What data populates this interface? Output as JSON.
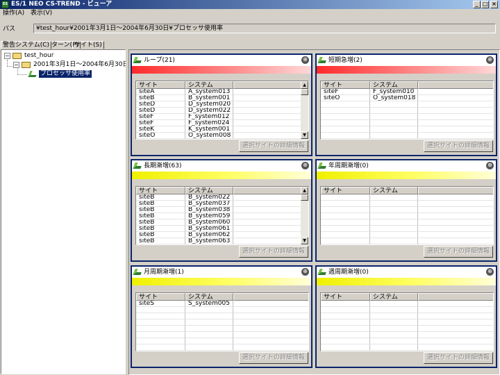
{
  "window": {
    "title": "ES/1 NEO CS-TREND - ビューア",
    "icon_text": "ES",
    "controls": [
      "_",
      "□",
      "×"
    ]
  },
  "menu": {
    "items": [
      "操作(A)",
      "表示(V)"
    ]
  },
  "path": {
    "label": "パス",
    "value": "¥test_hour¥2001年3月1日～2004年6月30日¥プロセッサ使用率"
  },
  "tabs": [
    "警告システム(C)",
    "パターン(P)",
    "サイト(S)"
  ],
  "tree": {
    "root": {
      "expander": "−",
      "label": "test_hour"
    },
    "period": {
      "expander": "−",
      "label": "2001年3月1日～2004年6月30日"
    },
    "leaf": {
      "label": "プロセッサ使用率"
    }
  },
  "columns": {
    "site": "サイト",
    "system": "システム"
  },
  "detail_button_label": "選択サイトの詳細情報",
  "collapse_icon": "⊕",
  "panels": [
    {
      "title": "ループ(21)",
      "bar": "red",
      "rows": [
        [
          "siteA",
          "A_system013"
        ],
        [
          "siteB",
          "B_system001"
        ],
        [
          "siteD",
          "D_system020"
        ],
        [
          "siteD",
          "D_system022"
        ],
        [
          "siteF",
          "F_system012"
        ],
        [
          "siteF",
          "F_system024"
        ],
        [
          "siteK",
          "K_system001"
        ],
        [
          "siteO",
          "O_system008"
        ]
      ]
    },
    {
      "title": "短期急増(2)",
      "bar": "red",
      "rows": [
        [
          "siteF",
          "F_system010"
        ],
        [
          "siteO",
          "O_system018"
        ]
      ]
    },
    {
      "title": "長期漸増(63)",
      "bar": "yellow",
      "rows": [
        [
          "siteB",
          "B_system022"
        ],
        [
          "siteB",
          "B_system037"
        ],
        [
          "siteB",
          "B_system038"
        ],
        [
          "siteB",
          "B_system059"
        ],
        [
          "siteB",
          "B_system060"
        ],
        [
          "siteB",
          "B_system061"
        ],
        [
          "siteB",
          "B_system062"
        ],
        [
          "siteB",
          "B_system063"
        ]
      ]
    },
    {
      "title": "年周期漸増(0)",
      "bar": "yellow",
      "rows": []
    },
    {
      "title": "月周期漸増(1)",
      "bar": "yellow",
      "rows": [
        [
          "siteS",
          "S_system005"
        ]
      ]
    },
    {
      "title": "週周期漸増(0)",
      "bar": "yellow",
      "rows": []
    }
  ]
}
